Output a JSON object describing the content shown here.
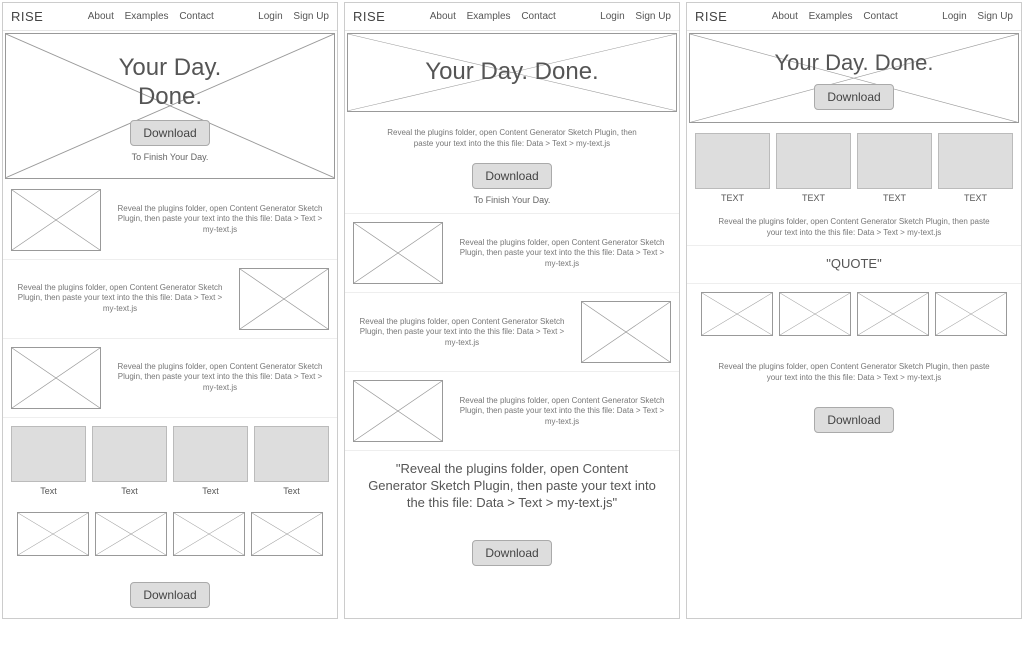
{
  "brand": "RISE",
  "nav": {
    "about": "About",
    "examples": "Examples",
    "contact": "Contact"
  },
  "auth": {
    "login": "Login",
    "signup": "Sign Up"
  },
  "hero": {
    "title_a": "Your Day.\nDone.",
    "title_b": "Your Day. Done.",
    "download": "Download",
    "tagline": "To Finish Your Day."
  },
  "lorem": "Reveal the plugins folder, open Content Generator Sketch Plugin, then paste your text into the this file: Data > Text > my-text.js",
  "quote_long": "\"Reveal the plugins folder, open Content Generator Sketch Plugin, then paste your text into the this file: Data > Text > my-text.js\"",
  "quote_short": "\"QUOTE\"",
  "grid_caption_a": "Text",
  "grid_caption_b": "TEXT"
}
